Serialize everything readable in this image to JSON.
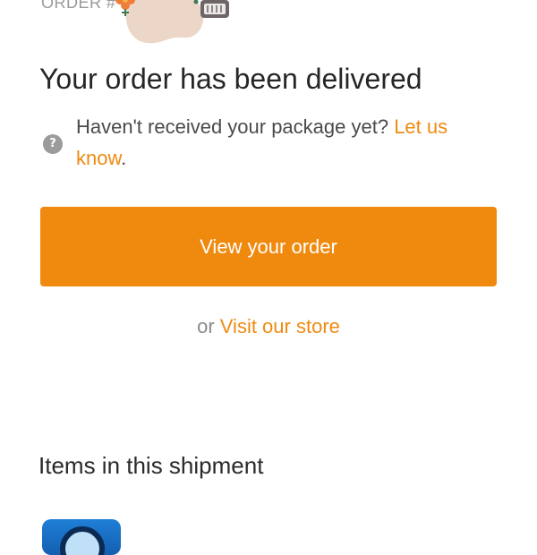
{
  "header": {
    "order_label": "ORDER #"
  },
  "headline": "Your order has been delivered",
  "help": {
    "icon": "question-circle-icon",
    "text_prefix": "Haven't received your package yet? ",
    "link_text": "Let us know",
    "text_suffix": "."
  },
  "actions": {
    "view_order_label": "View your order",
    "or_text": "or ",
    "visit_store_label": "Visit our store"
  },
  "shipment": {
    "section_title": "Items in this shipment"
  },
  "colors": {
    "accent": "#f08a0f",
    "link": "#ef8a12",
    "icon_gray": "#9b9b9b"
  }
}
